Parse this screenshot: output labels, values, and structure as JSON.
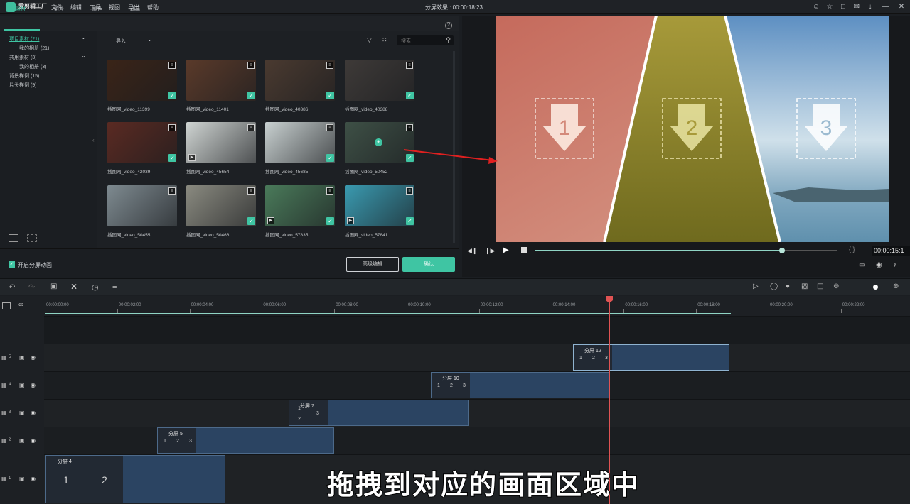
{
  "app": {
    "name": "爱剪辑工厂"
  },
  "menu": [
    "文件",
    "编辑",
    "工具",
    "视图",
    "导出",
    "帮助"
  ],
  "window_title": "分屏效果 : 00:00:18:23",
  "library": {
    "tabs": [
      "素材",
      "影片",
      "颜色",
      "动画"
    ],
    "tree": [
      {
        "label": "项目素材 (21)"
      },
      {
        "label": "我的相册 (21)"
      },
      {
        "label": "共用素材 (3)"
      },
      {
        "label": "我的相册 (3)"
      },
      {
        "label": "背景样例 (15)"
      },
      {
        "label": "片头样例 (9)"
      }
    ],
    "import_label": "导入",
    "search_placeholder": "搜索",
    "items": [
      {
        "label": "插图网_video_11399",
        "color": "#3a2418"
      },
      {
        "label": "插图网_video_11401",
        "color": "#5a3a2a"
      },
      {
        "label": "插图网_video_40386",
        "color": "#4a3a30"
      },
      {
        "label": "插图网_video_40388",
        "color": "#3e3a38"
      },
      {
        "label": "插图网_video_42039",
        "color": "#5a2a22"
      },
      {
        "label": "插图网_video_45654",
        "color": "#cfd4d2"
      },
      {
        "label": "插图网_video_45685",
        "color": "#c8d0d0"
      },
      {
        "label": "插图网_video_50452",
        "color": "#3e5046"
      },
      {
        "label": "插图网_video_50455",
        "color": "#7e8a90"
      },
      {
        "label": "插图网_video_50466",
        "color": "#8a8a80"
      },
      {
        "label": "插图网_video_57835",
        "color": "#4a7a5a"
      },
      {
        "label": "插图网_video_57841",
        "color": "#3a9ab0"
      }
    ],
    "checkbox_label": "开启分屏动画",
    "advanced_button": "高级编辑",
    "ok_button": "确认"
  },
  "preview": {
    "zones": [
      "1",
      "2",
      "3"
    ],
    "timecode": "00:00:15:1",
    "progress": 0.82
  },
  "timeline": {
    "ticks": [
      "00:00:00:00",
      "00:00:02:00",
      "00:00:04:00",
      "00:00:06:00",
      "00:00:08:00",
      "00:00:10:00",
      "00:00:12:00",
      "00:00:14:00",
      "00:00:16:00",
      "00:00:18:00",
      "00:00:20:00",
      "00:00:22:00"
    ],
    "clips": [
      {
        "title": "分屏 12",
        "nums": [
          "1",
          "2",
          "3"
        ]
      },
      {
        "title": "分屏 10",
        "nums": [
          "1",
          "2",
          "3"
        ]
      },
      {
        "title": "分屏 7",
        "nums": [
          "1",
          "2",
          "3"
        ]
      },
      {
        "title": "分屏 5",
        "nums": [
          "1",
          "2",
          "3"
        ]
      },
      {
        "title": "分屏 4",
        "nums": [
          "1",
          "2"
        ]
      }
    ],
    "track_numbers": [
      "5",
      "4",
      "3",
      "2",
      "1"
    ]
  },
  "subtitle": "拖拽到对应的画面区域中"
}
